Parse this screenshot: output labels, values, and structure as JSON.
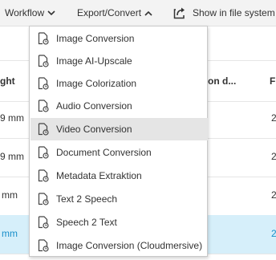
{
  "toolbar": {
    "workflow_label": "Workflow",
    "export_label": "Export/Convert",
    "show_label": "Show in file system"
  },
  "table": {
    "headers": [
      "ght",
      "on d...",
      "F"
    ],
    "rows": [
      {
        "col1": "9 mm",
        "col3": "2"
      },
      {
        "col1": "9 mm",
        "col3": "2"
      },
      {
        "col1": "mm",
        "col3": "2"
      },
      {
        "col1": "mm",
        "col3": "2",
        "selected": true
      }
    ]
  },
  "menu": {
    "items": [
      {
        "label": "Image Conversion"
      },
      {
        "label": "Image AI-Upscale"
      },
      {
        "label": "Image Colorization"
      },
      {
        "label": "Audio Conversion"
      },
      {
        "label": "Video Conversion",
        "hovered": true
      },
      {
        "label": "Document Conversion"
      },
      {
        "label": "Metadata Extraktion"
      },
      {
        "label": "Text 2 Speech"
      },
      {
        "label": "Speech 2 Text"
      },
      {
        "label": "Image Conversion (Cloudmersive)"
      }
    ]
  },
  "colors": {
    "selected_row_bg": "#d6effa",
    "selected_row_text": "#1a8fc9",
    "hover_bg": "#e5e5e5"
  }
}
